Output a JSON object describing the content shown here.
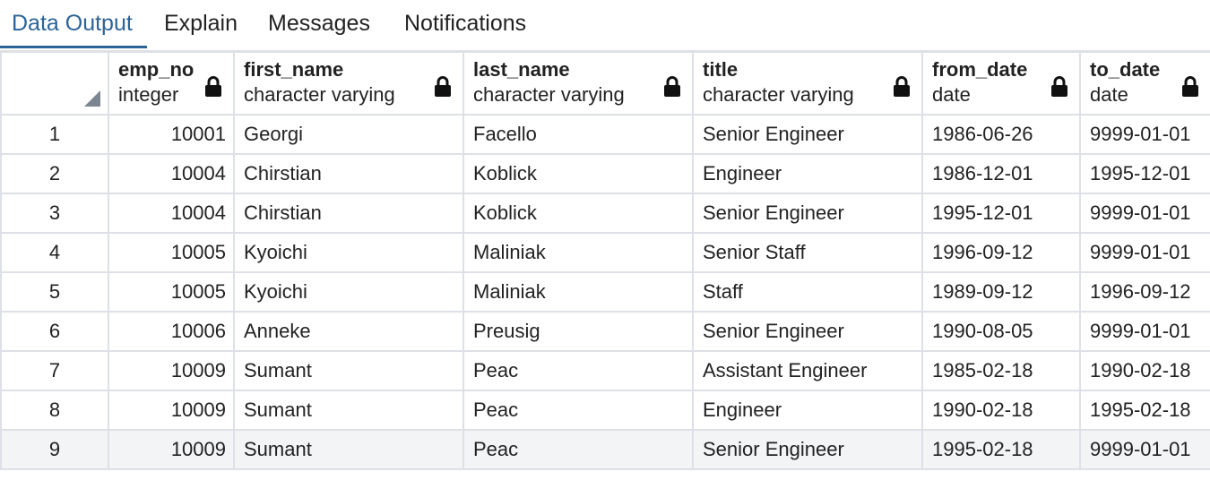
{
  "tabs": [
    {
      "label": "Data Output",
      "active": true
    },
    {
      "label": "Explain",
      "active": false
    },
    {
      "label": "Messages",
      "active": false
    },
    {
      "label": "Notifications",
      "active": false
    }
  ],
  "colors": {
    "accent": "#2c6396",
    "grid_border": "#dde0e6",
    "selected_row": "#f3f4f6"
  },
  "columns": [
    {
      "name": "emp_no",
      "type": "integer",
      "icon": "lock-icon"
    },
    {
      "name": "first_name",
      "type": "character varying",
      "icon": "lock-icon"
    },
    {
      "name": "last_name",
      "type": "character varying",
      "icon": "lock-icon"
    },
    {
      "name": "title",
      "type": "character varying",
      "icon": "lock-icon"
    },
    {
      "name": "from_date",
      "type": "date",
      "icon": "lock-icon"
    },
    {
      "name": "to_date",
      "type": "date",
      "icon": "lock-icon"
    }
  ],
  "rows": [
    {
      "n": "1",
      "emp_no": "10001",
      "first_name": "Georgi",
      "last_name": "Facello",
      "title": "Senior Engineer",
      "from_date": "1986-06-26",
      "to_date": "9999-01-01"
    },
    {
      "n": "2",
      "emp_no": "10004",
      "first_name": "Chirstian",
      "last_name": "Koblick",
      "title": "Engineer",
      "from_date": "1986-12-01",
      "to_date": "1995-12-01"
    },
    {
      "n": "3",
      "emp_no": "10004",
      "first_name": "Chirstian",
      "last_name": "Koblick",
      "title": "Senior Engineer",
      "from_date": "1995-12-01",
      "to_date": "9999-01-01"
    },
    {
      "n": "4",
      "emp_no": "10005",
      "first_name": "Kyoichi",
      "last_name": "Maliniak",
      "title": "Senior Staff",
      "from_date": "1996-09-12",
      "to_date": "9999-01-01"
    },
    {
      "n": "5",
      "emp_no": "10005",
      "first_name": "Kyoichi",
      "last_name": "Maliniak",
      "title": "Staff",
      "from_date": "1989-09-12",
      "to_date": "1996-09-12"
    },
    {
      "n": "6",
      "emp_no": "10006",
      "first_name": "Anneke",
      "last_name": "Preusig",
      "title": "Senior Engineer",
      "from_date": "1990-08-05",
      "to_date": "9999-01-01"
    },
    {
      "n": "7",
      "emp_no": "10009",
      "first_name": "Sumant",
      "last_name": "Peac",
      "title": "Assistant Engineer",
      "from_date": "1985-02-18",
      "to_date": "1990-02-18"
    },
    {
      "n": "8",
      "emp_no": "10009",
      "first_name": "Sumant",
      "last_name": "Peac",
      "title": "Engineer",
      "from_date": "1990-02-18",
      "to_date": "1995-02-18"
    },
    {
      "n": "9",
      "emp_no": "10009",
      "first_name": "Sumant",
      "last_name": "Peac",
      "title": "Senior Engineer",
      "from_date": "1995-02-18",
      "to_date": "9999-01-01"
    }
  ]
}
